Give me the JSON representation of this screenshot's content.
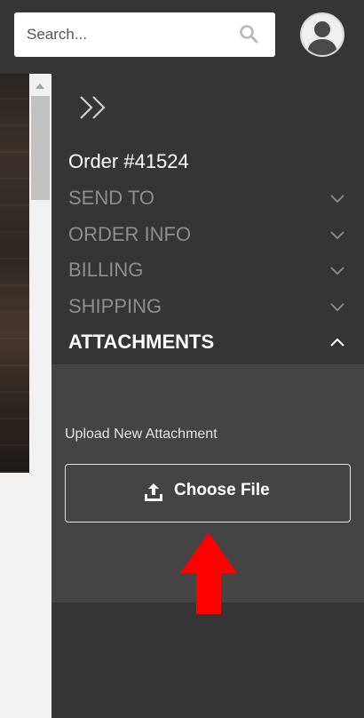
{
  "search": {
    "placeholder": "Search...",
    "icon": "search-icon"
  },
  "user": {
    "icon": "avatar-icon"
  },
  "panel": {
    "collapse_icon": "double-chevron-right-icon",
    "order_title": "Order #41524",
    "sections": [
      {
        "label": "SEND TO",
        "expanded": false
      },
      {
        "label": "ORDER INFO",
        "expanded": false
      },
      {
        "label": "BILLING",
        "expanded": false
      },
      {
        "label": "SHIPPING",
        "expanded": false
      },
      {
        "label": "ATTACHMENTS",
        "expanded": true
      }
    ],
    "attachments": {
      "upload_label": "Upload New Attachment",
      "choose_file_label": "Choose File",
      "choose_file_icon": "upload-icon"
    }
  },
  "annotation": {
    "icon": "red-up-arrow",
    "color": "#ff0000"
  },
  "colors": {
    "panel_bg": "#353535",
    "section_body_bg": "#444444",
    "inactive_text": "#8e8e8e",
    "active_text": "#ffffff"
  }
}
